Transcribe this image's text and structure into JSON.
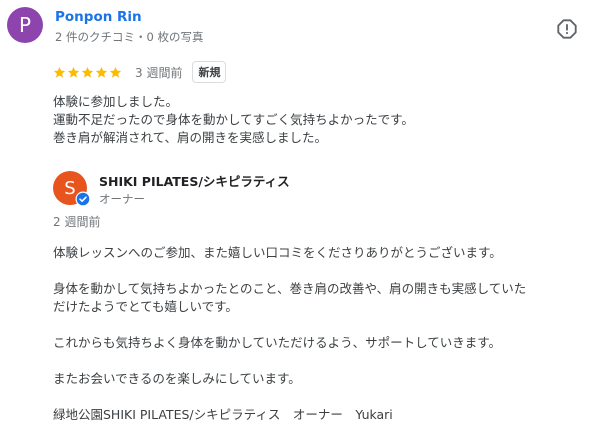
{
  "colors": {
    "reviewer_avatar_bg": "#8e44ad",
    "owner_avatar_bg": "#e8541d",
    "star": "#fbbc04",
    "link": "#1a73e8",
    "verified": "#1a73e8"
  },
  "reviewer": {
    "initial": "P",
    "name": "Ponpon Rin",
    "meta": "2 件のクチコミ・0 枚の写真"
  },
  "report_icon": "report-flag-icon",
  "rating": {
    "stars": 5,
    "max_stars": 5,
    "date": "3 週間前",
    "badge": "新規"
  },
  "review_lines": [
    "体験に参加しました。",
    "運動不足だったので身体を動かしてすごく気持ちよかったです。",
    "巻き肩が解消されて、肩の開きを実感しました。"
  ],
  "owner": {
    "initial": "S",
    "name": "SHIKI PILATES/シキピラティス",
    "role": "オーナー",
    "verified_icon": "verified-check-icon"
  },
  "reply": {
    "date": "2 週間前",
    "lines": [
      "体験レッスンへのご参加、また嬉しい口コミをくださりありがとうございます。",
      "",
      "身体を動かして気持ちよかったとのこと、巻き肩の改善や、肩の開きも実感していた",
      "だけたようでとても嬉しいです。",
      "",
      "これからも気持ちよく身体を動かしていただけるよう、サポートしていきます。",
      "",
      "またお会いできるのを楽しみにしています。",
      "",
      "緑地公園SHIKI PILATES/シキピラティス　オーナー　Yukari"
    ]
  }
}
